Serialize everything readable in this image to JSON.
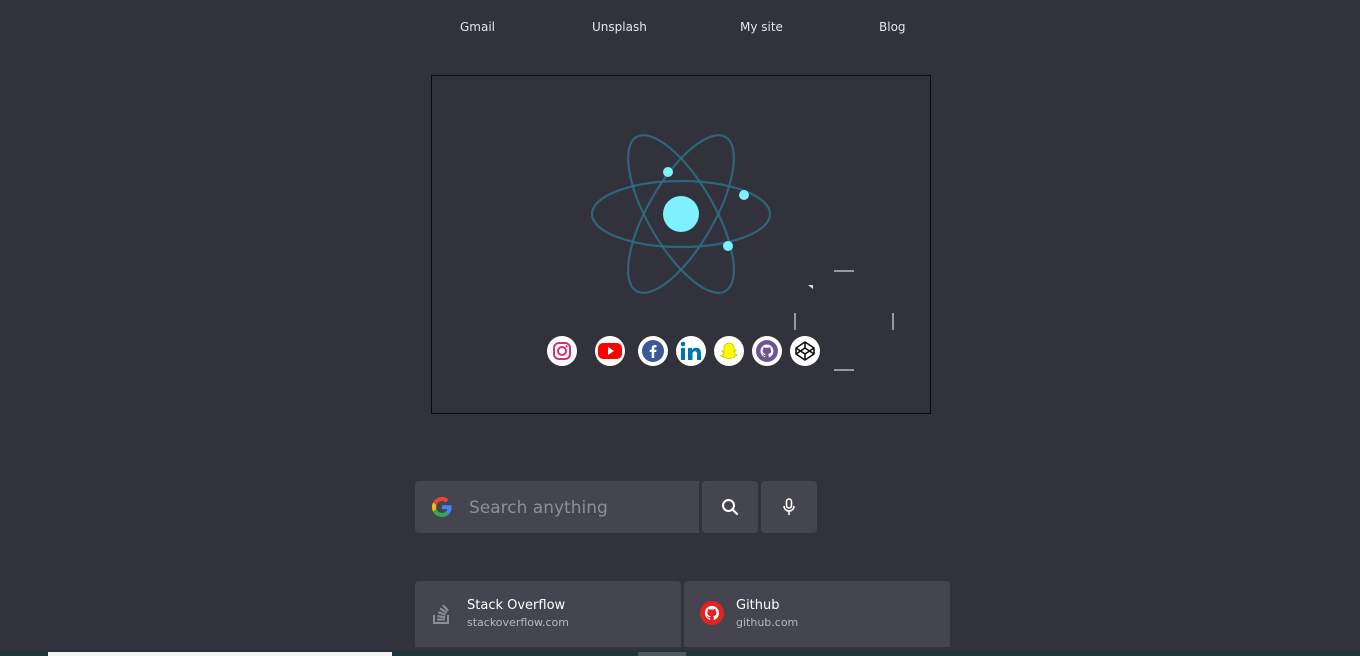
{
  "nav": {
    "links": [
      {
        "label": "Gmail"
      },
      {
        "label": "Unsplash"
      },
      {
        "label": "My site"
      },
      {
        "label": "Blog"
      }
    ]
  },
  "hero": {
    "logo_icon": "atom-logo-icon",
    "accent": "#7ef0ff",
    "socials": [
      {
        "icon": "instagram-icon",
        "color": "#e1306c"
      },
      {
        "icon": "youtube-icon",
        "color": "#ff0000"
      },
      {
        "icon": "facebook-icon",
        "color": "#3b5998"
      },
      {
        "icon": "linkedin-icon",
        "color": "#0077b5"
      },
      {
        "icon": "snapchat-icon",
        "color": "#fffc00"
      },
      {
        "icon": "github-icon",
        "color": "#6e5494"
      },
      {
        "icon": "codepen-icon",
        "color": "#000000"
      }
    ]
  },
  "search": {
    "placeholder": "Search anything",
    "value": "",
    "search_icon": "search-icon",
    "mic_icon": "microphone-icon"
  },
  "shortcuts": [
    {
      "name": "Stack Overflow",
      "url": "stackoverflow.com",
      "icon": "stackoverflow-icon"
    },
    {
      "name": "Github",
      "url": "github.com",
      "icon": "github-icon"
    }
  ]
}
